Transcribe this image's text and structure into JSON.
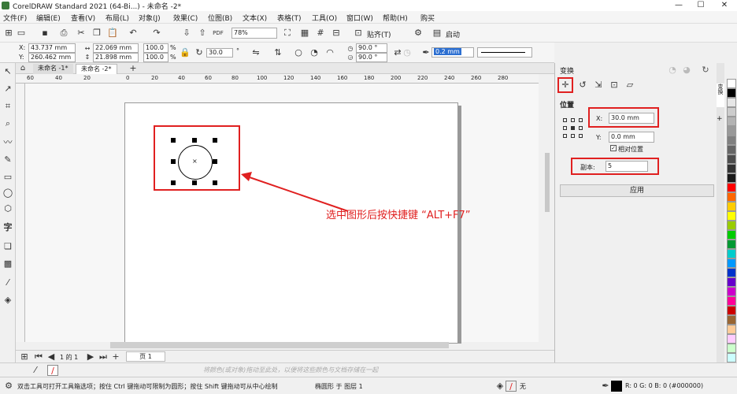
{
  "titlebar": {
    "title": "CorelDRAW Standard 2021 (64-Bi...) - 未命名 -2*",
    "min": "—",
    "max": "☐",
    "close": "✕"
  },
  "menu": [
    "文件(F)",
    "编辑(E)",
    "查看(V)",
    "布局(L)",
    "对象(J)",
    "效果(C)",
    "位图(B)",
    "文本(X)",
    "表格(T)",
    "工具(O)",
    "窗口(W)",
    "帮助(H)",
    "购买"
  ],
  "toolbar": {
    "zoom": "78%",
    "snap_label": "贴齐(T)",
    "launch_label": "启动"
  },
  "propbar": {
    "x_label": "X:",
    "x_value": "43.737 mm",
    "y_label": "Y:",
    "y_value": "260.462 mm",
    "w_value": "22.069 mm",
    "h_value": "21.898 mm",
    "scale_w": "100.0",
    "scale_h": "100.0",
    "percent": "%",
    "rotation": "30.0",
    "degree": "°",
    "arc_start": "90.0 °",
    "arc_end": "90.0 °",
    "outline_width": "0.2 mm"
  },
  "tabs": {
    "tab1": "未命名 -1*",
    "tab2": "未命名 -2*"
  },
  "ruler": {
    "marks": [
      "60",
      "40",
      "20",
      "0",
      "20",
      "40",
      "60",
      "80",
      "100",
      "120",
      "140",
      "160",
      "180",
      "200",
      "220",
      "240",
      "260",
      "280"
    ]
  },
  "annotation": {
    "text": "选中图形后按快捷键 “ALT+F7”"
  },
  "docker": {
    "title": "变换",
    "side_tab": "变换",
    "section": "位置",
    "x_label": "X:",
    "x_value": "30.0 mm",
    "y_label": "Y:",
    "y_value": "0.0 mm",
    "relative_label": "相对位置",
    "copies_label": "副本:",
    "copies_value": "5",
    "apply_label": "应用"
  },
  "pagebar": {
    "page_info": "1 的 1",
    "page_tab": "页 1"
  },
  "colorbar": {
    "hint": "将颜色(或对象)拖动至此处，以便将这些颜色与文档存储在一起"
  },
  "status": {
    "hint": "双击工具可打开工具箱选项；按住 Ctrl 键拖动可限制为圆形；按住 Shift 键拖动可从中心绘制",
    "object_info": "椭圆形 于 图层 1",
    "fill_none": "无",
    "color_info": "R: 0 G: 0 B: 0 (#000000)"
  },
  "palette": [
    "#ffffff",
    "#000000",
    "#e6e6e6",
    "#cccccc",
    "#b3b3b3",
    "#999999",
    "#808080",
    "#666666",
    "#4d4d4d",
    "#333333",
    "#1a1a1a",
    "#ff0000",
    "#ff6600",
    "#ffcc00",
    "#ffff00",
    "#99cc00",
    "#00cc00",
    "#009933",
    "#00cccc",
    "#0099ff",
    "#0033cc",
    "#6600cc",
    "#cc00cc",
    "#ff0099",
    "#cc0000",
    "#996633",
    "#ffcc99",
    "#ffccff",
    "#ccffcc",
    "#ccffff"
  ]
}
